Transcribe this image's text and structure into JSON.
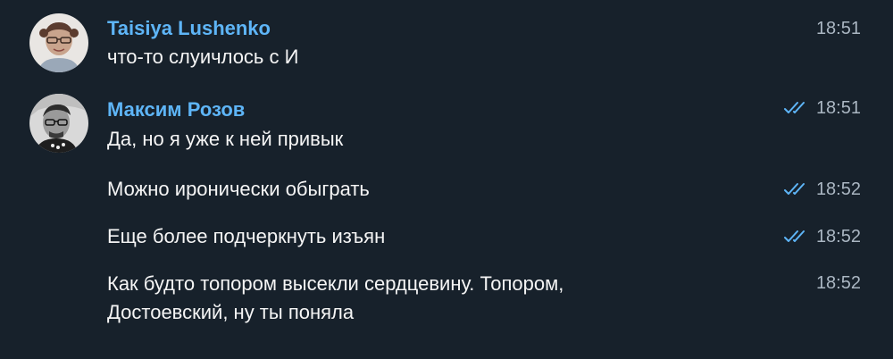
{
  "colors": {
    "background": "#17212b",
    "sender_name": "#5eb5f7",
    "text": "#f5f5f5",
    "time": "#aab6c2",
    "read_ticks": "#5eb5f7"
  },
  "messages": [
    {
      "sender": "Taisiya Lushenko",
      "text": "что-то слуичлось с И",
      "time": "18:51",
      "avatar_icon": "user-avatar-taisiya"
    },
    {
      "sender": "Максим Розов",
      "text": "Да, но я уже к ней привык",
      "time": "18:51",
      "status_icon": "double-check-icon",
      "avatar_icon": "user-avatar-maxim"
    },
    {
      "text": "Можно иронически обыграть",
      "time": "18:52",
      "status_icon": "double-check-icon"
    },
    {
      "text": "Еще более подчеркнуть изъян",
      "time": "18:52",
      "status_icon": "double-check-icon"
    },
    {
      "text": "Как будто топором высекли сердцевину. Топором, Достоевский, ну ты поняла",
      "time": "18:52"
    }
  ]
}
